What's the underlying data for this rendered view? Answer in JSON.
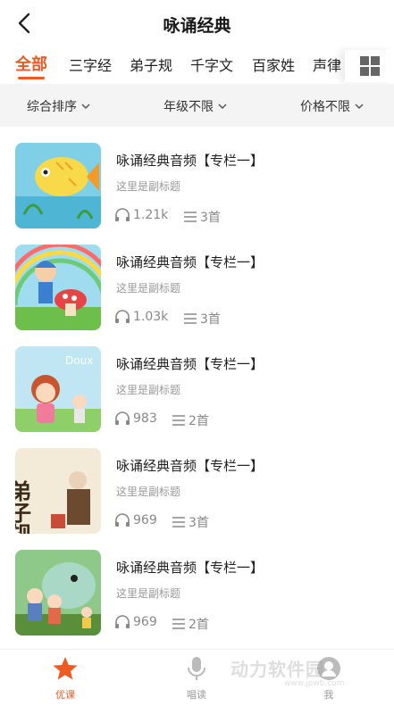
{
  "header": {
    "title": "咏诵经典"
  },
  "tabs": [
    {
      "label": "全部"
    },
    {
      "label": "三字经"
    },
    {
      "label": "弟子规"
    },
    {
      "label": "千字文"
    },
    {
      "label": "百家姓"
    },
    {
      "label": "声律"
    }
  ],
  "filters": [
    {
      "label": "综合排序"
    },
    {
      "label": "年级不限"
    },
    {
      "label": "价格不限"
    }
  ],
  "items": [
    {
      "title": "咏诵经典音频【专栏一】",
      "subtitle": "这里是副标题",
      "plays": "1.21k",
      "tracks": "3首"
    },
    {
      "title": "咏诵经典音频【专栏一】",
      "subtitle": "这里是副标题",
      "plays": "1.03k",
      "tracks": "3首"
    },
    {
      "title": "咏诵经典音频【专栏一】",
      "subtitle": "这里是副标题",
      "plays": "983",
      "tracks": "2首"
    },
    {
      "title": "咏诵经典音频【专栏一】",
      "subtitle": "这里是副标题",
      "plays": "969",
      "tracks": "3首"
    },
    {
      "title": "咏诵经典音频【专栏一】",
      "subtitle": "这里是副标题",
      "plays": "969",
      "tracks": "2首"
    }
  ],
  "covers": {
    "item3_text": "Doux",
    "item4_text": "弟子规"
  },
  "bottom_nav": [
    {
      "label": "优课",
      "icon": "star-icon"
    },
    {
      "label": "唱读",
      "icon": "microphone-icon"
    },
    {
      "label": "我",
      "icon": "user-icon"
    }
  ],
  "watermark": {
    "text": "动力软件园",
    "sub": "www.jpwb.com"
  },
  "colors": {
    "accent": "#f05a22",
    "filter_bg": "#f4f4f4"
  }
}
